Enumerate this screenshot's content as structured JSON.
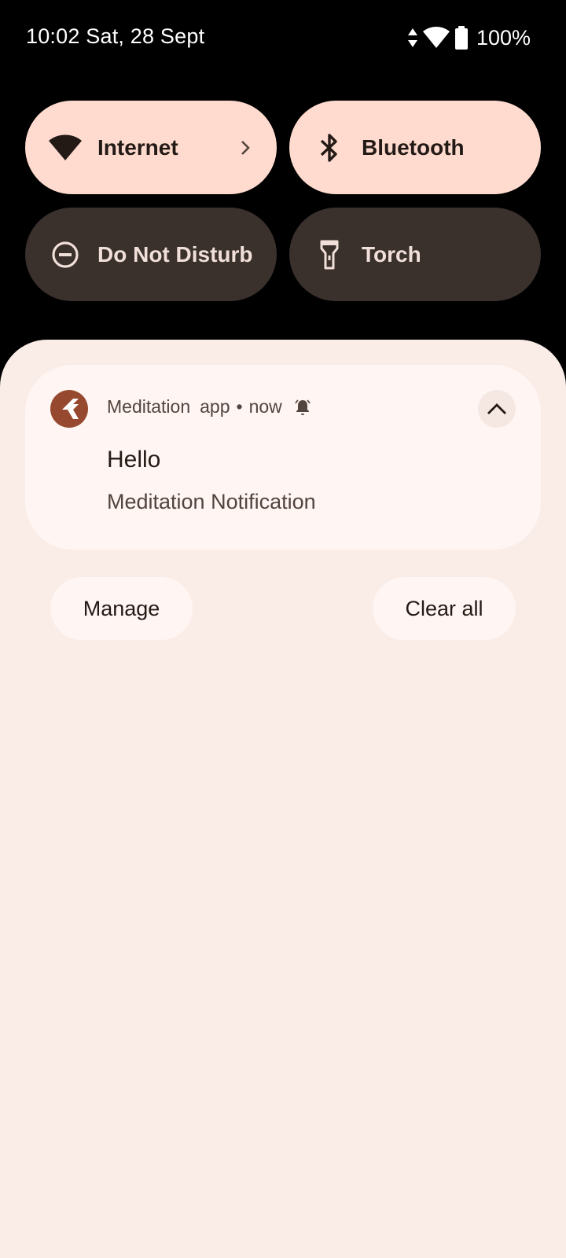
{
  "status_bar": {
    "time_date": "10:02 Sat, 28 Sept",
    "battery": "100%",
    "icons": [
      "data-arrows-icon",
      "wifi-icon",
      "battery-icon"
    ]
  },
  "quick_settings": {
    "tiles": [
      {
        "label": "Internet",
        "icon": "wifi-icon",
        "state": "on",
        "has_chevron": true
      },
      {
        "label": "Bluetooth",
        "icon": "bluetooth-icon",
        "state": "on"
      },
      {
        "label": "Do Not Disturb",
        "icon": "do-not-disturb-icon",
        "state": "off"
      },
      {
        "label": "Torch",
        "icon": "torch-icon",
        "state": "off"
      }
    ]
  },
  "notification": {
    "app_name": "Meditation",
    "sub_text": "app",
    "separator": "•",
    "time": "now",
    "title": "Hello",
    "text": "Meditation Notification",
    "app_icon_color": "#97492f"
  },
  "actions": {
    "manage": "Manage",
    "clear_all": "Clear all"
  },
  "colors": {
    "tile_on": "#ffdbcf",
    "tile_off": "#3a302c",
    "shade_bg": "#faece7",
    "card_bg": "#fff5f2"
  }
}
